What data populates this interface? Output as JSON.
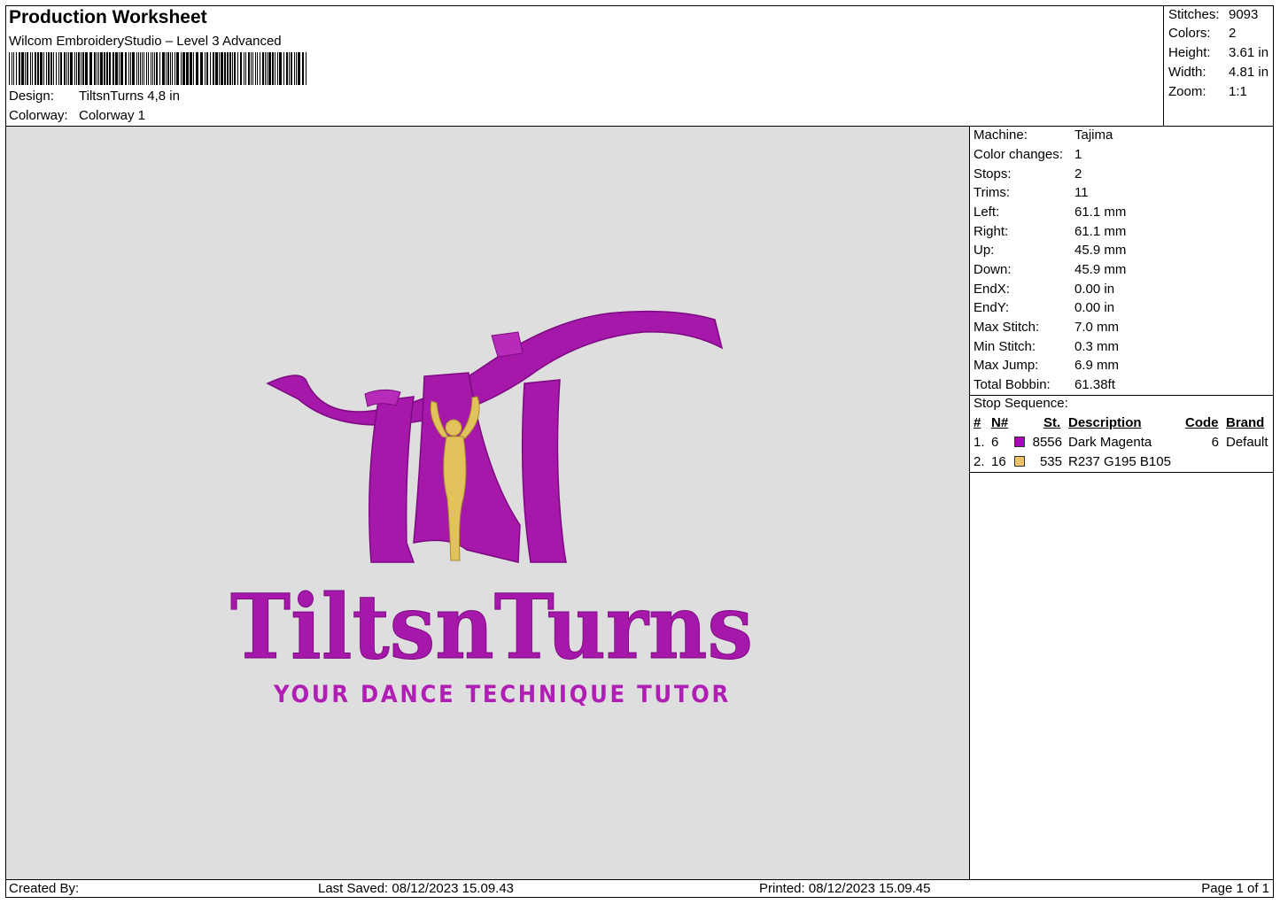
{
  "header": {
    "title": "Production Worksheet",
    "software": "Wilcom EmbroideryStudio – Level 3 Advanced",
    "design_label": "Design:",
    "design_value": "TiltsnTurns 4,8 in",
    "colorway_label": "Colorway:",
    "colorway_value": "Colorway 1"
  },
  "stats": [
    {
      "label": "Stitches:",
      "value": "9093"
    },
    {
      "label": "Colors:",
      "value": "2"
    },
    {
      "label": "Height:",
      "value": "3.61 in"
    },
    {
      "label": "Width:",
      "value": "4.81 in"
    },
    {
      "label": "Zoom:",
      "value": "1:1"
    }
  ],
  "machine_info": [
    {
      "label": "Machine:",
      "value": "Tajima"
    },
    {
      "label": "Color changes:",
      "value": "1"
    },
    {
      "label": "Stops:",
      "value": "2"
    },
    {
      "label": "Trims:",
      "value": "11"
    },
    {
      "label": "Left:",
      "value": "61.1 mm"
    },
    {
      "label": "Right:",
      "value": "61.1 mm"
    },
    {
      "label": "Up:",
      "value": "45.9 mm"
    },
    {
      "label": "Down:",
      "value": "45.9 mm"
    },
    {
      "label": "EndX:",
      "value": "0.00 in"
    },
    {
      "label": "EndY:",
      "value": "0.00 in"
    },
    {
      "label": "Max Stitch:",
      "value": "7.0 mm"
    },
    {
      "label": "Min Stitch:",
      "value": "0.3 mm"
    },
    {
      "label": "Max Jump:",
      "value": "6.9 mm"
    },
    {
      "label": "Total Bobbin:",
      "value": "61.38ft"
    }
  ],
  "stop_sequence": {
    "title": "Stop Sequence:",
    "columns": {
      "num": "#",
      "n": "N#",
      "st": "St.",
      "description": "Description",
      "code": "Code",
      "brand": "Brand"
    },
    "rows": [
      {
        "num": "1.",
        "n": "6",
        "color": "#b000b5",
        "st": "8556",
        "description": "Dark Magenta",
        "code": "6",
        "brand": "Default"
      },
      {
        "num": "2.",
        "n": "16",
        "color": "#edc369",
        "st": "535",
        "description": "R237 G195 B105",
        "code": "",
        "brand": ""
      }
    ]
  },
  "design": {
    "brand": "TiltsnTurns",
    "tagline": "YOUR DANCE TECHNIQUE TUTOR",
    "colors": {
      "magenta": "#a518a9",
      "gold": "#e2c25a",
      "canvas": "#dedede"
    }
  },
  "footer": {
    "created_by": "Created By:",
    "last_saved": "Last Saved: 08/12/2023 15.09.43",
    "printed": "Printed: 08/12/2023 15.09.45",
    "page": "Page 1 of 1"
  }
}
